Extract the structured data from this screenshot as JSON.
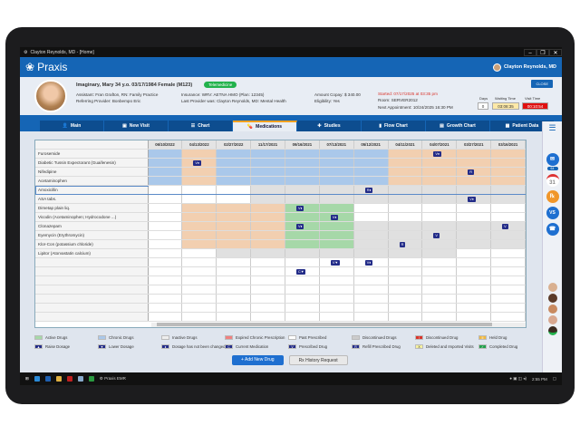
{
  "window": {
    "title": "Clayton Reynolds, MD - [Home]",
    "controls": [
      "–",
      "❐",
      "✕"
    ]
  },
  "app": {
    "logo": "Praxis",
    "user": "Clayton Reynolds, MD"
  },
  "patient": {
    "name": "Imaginary, Mary 34 y.o. 03/17/1984 Female (M123)",
    "telemedicine": "Telemedicine",
    "assistant": "Assistant: Fran Grafton, RN: Family Practice",
    "referring": "Referring Provider: Bonbempo Eric",
    "insurance": "Insurance: WRV: AETNA HMO (Plan: 12345)",
    "last_provider": "Last Provider was: Clayton Reynolds, MD: Mental Health",
    "copay": "Amount Copay: $ 340.00",
    "eligibility": "Eligibility: Yes",
    "started": "Started: 07/17/2025 at 03:35 pm",
    "room": "Room: SERVER2012",
    "next_appt": "Next Appointment: 10/24/2025 16:30 PM",
    "close": "CLOSE",
    "days_label": "Days",
    "days": "0",
    "waiting_label": "Waiting Time",
    "waiting": "03:08:35",
    "visit_label": "Visit Time",
    "visit": "00:10:54"
  },
  "tabs": [
    {
      "label": "Main"
    },
    {
      "label": "New Visit"
    },
    {
      "label": "Chart"
    },
    {
      "label": "Medications",
      "active": true
    },
    {
      "label": "Studies"
    },
    {
      "label": "Flow Chart"
    },
    {
      "label": "Growth Chart"
    },
    {
      "label": "Patient Data"
    }
  ],
  "grid": {
    "dates": [
      "06/10/2022",
      "04/13/2022",
      "02/27/2022",
      "11/17/2021",
      "09/16/2021",
      "07/13/2021",
      "05/12/2021",
      "04/11/2021",
      "04/07/2021",
      "03/27/2021",
      "03/16/2021"
    ],
    "status_colors": {
      "B": "#aac8ea",
      "O": "#f2cfb0",
      "G": "#a6d8a8",
      "W": "#ffffff",
      "D": "#e0e0e0"
    },
    "rows": [
      {
        "name": "Furosemide",
        "cells": "BOBBBBBOOOO",
        "badges": {
          "8": "V♦"
        }
      },
      {
        "name": "Diabetic Tussin Expectorant (Guaifenesin)",
        "cells": "BOBBBBBOOOO",
        "badges": {
          "1": "V♦"
        }
      },
      {
        "name": "Nifedipine",
        "cells": "BOBBBBBOOOO",
        "badges": {
          "9": "R"
        }
      },
      {
        "name": "Acetaminophen",
        "cells": "BOBBBBBOOOO",
        "badges": {}
      },
      {
        "name": "Amoxicillin",
        "cells": "WWWDDDDDDDD",
        "badges": {
          "6": "R♦"
        },
        "selected": true
      },
      {
        "name": "ASA tabs.",
        "cells": "WWWDDDDDDDD",
        "badges": {
          "9": "V♦"
        }
      },
      {
        "name": "Dimetap plain liq.",
        "cells": "WOOOGGWWWWW",
        "badges": {
          "4": "V♦"
        }
      },
      {
        "name": "Vicodin (Acetaminophen; Hydrocodone ...)",
        "cells": "WOOOGGWWWWW",
        "badges": {
          "5": "V♦"
        }
      },
      {
        "name": "Clonazepam",
        "cells": "WOOOGGDDDDD",
        "badges": {
          "4": "V♦",
          "10": "V"
        }
      },
      {
        "name": "Eyemycin (Erythromycin)",
        "cells": "WOOOGGDDDDD",
        "badges": {
          "8": "V"
        }
      },
      {
        "name": "Klor-Con (potassium chloride)",
        "cells": "WOOOGGDDDDD",
        "badges": {
          "7": "R"
        }
      },
      {
        "name": "Lipitor (Atorvastatin calcium)",
        "cells": "WWDDDDDDDWW",
        "badges": {}
      },
      {
        "name": "",
        "cells": "WWWWWWWWWWW",
        "badges": {
          "5": "V▼",
          "6": "V♦"
        }
      },
      {
        "name": "",
        "cells": "WWWWWWWWWWW",
        "badges": {
          "4": "C▼"
        }
      },
      {
        "name": "",
        "cells": "WWWWWWWWWWW",
        "badges": {}
      },
      {
        "name": "",
        "cells": "WWWWWWWWWWW",
        "badges": {}
      },
      {
        "name": "",
        "cells": "WWWWWWWWWWW",
        "badges": {}
      },
      {
        "name": "",
        "cells": "WWWWWWWWWWW",
        "badges": {}
      },
      {
        "name": "",
        "cells": "WWWWWWWWWWW",
        "badges": {}
      }
    ]
  },
  "legend": [
    [
      {
        "label": "Active Drugs",
        "color": "#a6d8a8"
      },
      {
        "label": "Chronic Drugs",
        "color": "#aac8ea"
      },
      {
        "label": "Inactive Drugs",
        "color": "#eeeeee"
      },
      {
        "label": "Expired Chronic Prescription",
        "color": "#f08080"
      },
      {
        "label": "Past Prescribed",
        "color": "#ffffff"
      },
      {
        "label": "Discontinued Drugs",
        "color": "#cccccc"
      },
      {
        "label": "Discontinued Drug",
        "color": "#d9342b",
        "glyph": "!"
      },
      {
        "label": "Held Drug",
        "color": "#f0b840",
        "glyph": "II"
      }
    ],
    [
      {
        "label": "Raise Dosage",
        "color": "#232c88",
        "glyph": "▲"
      },
      {
        "label": "Lower Dosage",
        "color": "#232c88",
        "glyph": "▼"
      },
      {
        "label": "Dosage has not been changed",
        "color": "#232c88",
        "glyph": "♦"
      },
      {
        "label": "Current Medication",
        "color": "#232c88",
        "glyph": "C"
      },
      {
        "label": "Prescribed Drug",
        "color": "#232c88",
        "glyph": "V"
      },
      {
        "label": "Refill Prescribed Drug",
        "color": "#232c88",
        "glyph": "R"
      },
      {
        "label": "Deleted and Imported Visits",
        "color": "#f5f0a0",
        "glyph": "X"
      },
      {
        "label": "Completed Drug",
        "color": "#22a04c",
        "glyph": "✓"
      }
    ]
  ],
  "buttons": {
    "add": "+ Add New Drug",
    "rx": "Rx History Request"
  },
  "sidebar": {
    "mail_count": "64",
    "calendar": "31",
    "rx": "℞",
    "vs": "VS"
  },
  "taskbar": {
    "app": "Praxis EMR",
    "time": "2:55 PM"
  }
}
